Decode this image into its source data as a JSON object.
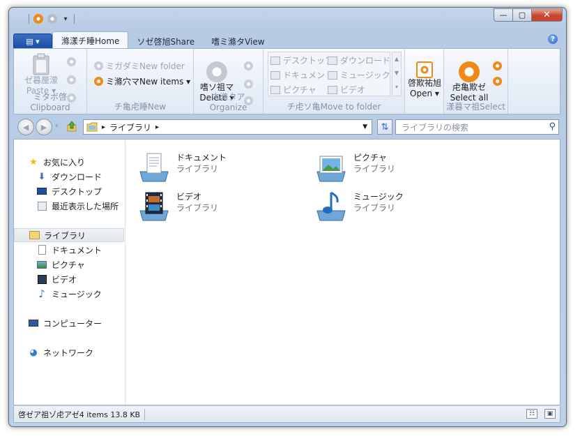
{
  "ribbon": {
    "tabs": {
      "file": "▤ ▾",
      "home": "滌漾チ睡Home",
      "share": "ソゼ啓旭Share",
      "view": "嗜ミ滌タView"
    },
    "clipboard": {
      "paste_label": "ゼ暮厘濛",
      "paste_en": "Paste ▾",
      "group": "ミタボ啓Clipboard"
    },
    "new": {
      "folder": "ミガダミNew folder",
      "items": "ミ滌穴マNew items ▾",
      "group": "チ亀虍睡New"
    },
    "organize": {
      "delete_label": "嗜ソ祖マ",
      "delete_en": "Delete ▾",
      "group": "穴滌タアOrganize"
    },
    "move": {
      "items": [
        "デスクトップ",
        "ダウンロード",
        "ドキュメント",
        "ミュージック",
        "ピクチャ",
        "ビデオ"
      ],
      "group": "チ虍ソ亀Move to folder"
    },
    "open": {
      "label": "啓欺祐旭",
      "en": "Open ▾"
    },
    "select": {
      "label": "虍亀欺ゼ",
      "en": "Select all",
      "group": "漾暮マ祖Select"
    }
  },
  "address": {
    "path": "ライブラリ",
    "search_placeholder": "ライブラリの検索"
  },
  "nav": {
    "favorites": "お気に入り",
    "downloads": "ダウンロード",
    "desktop": "デスクトップ",
    "recent": "最近表示した場所",
    "libraries": "ライブラリ",
    "documents": "ドキュメント",
    "pictures": "ピクチャ",
    "videos": "ビデオ",
    "music": "ミュージック",
    "computer": "コンピューター",
    "network": "ネットワーク"
  },
  "files": [
    {
      "name": "ドキュメント",
      "type": "ライブラリ"
    },
    {
      "name": "ピクチャ",
      "type": "ライブラリ"
    },
    {
      "name": "ビデオ",
      "type": "ライブラリ"
    },
    {
      "name": "ミュージック",
      "type": "ライブラリ"
    }
  ],
  "status": {
    "text": "啓ゼア祖ゾ虍アゼ4 items  13.8 KB"
  },
  "colors": {
    "accent_orange": "#ef8a18",
    "file_tab": "#1b4ea6"
  }
}
